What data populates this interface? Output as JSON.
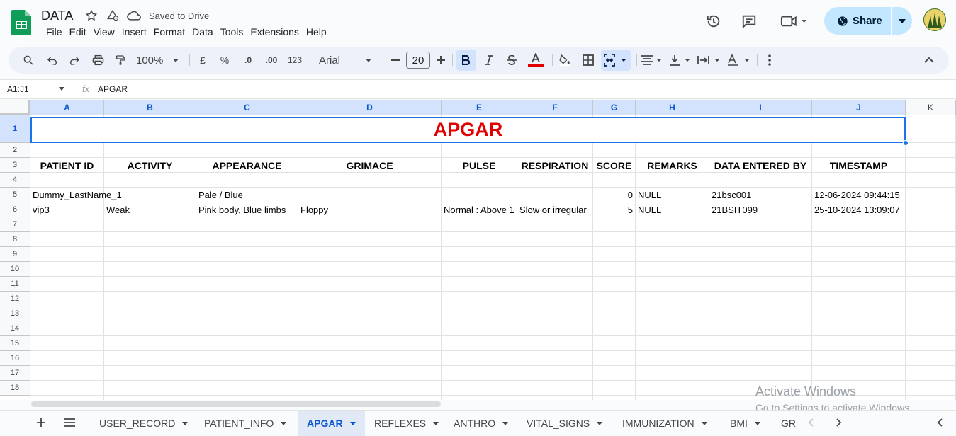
{
  "app": {
    "doc_title": "DATA",
    "saved_status": "Saved to Drive",
    "menu": [
      "File",
      "Edit",
      "View",
      "Insert",
      "Format",
      "Data",
      "Tools",
      "Extensions",
      "Help"
    ],
    "share_label": "Share",
    "accent": "#0b57d0"
  },
  "toolbar": {
    "zoom": "100%",
    "currency": "£",
    "percent": "%",
    "dec_decrease": ".0",
    "dec_increase": ".00",
    "number_format": "123",
    "font": "Arial",
    "font_size": "20"
  },
  "formula_bar": {
    "name_box": "A1:J1",
    "fx": "fx",
    "value": "APGAR"
  },
  "grid": {
    "columns": [
      "A",
      "B",
      "C",
      "D",
      "E",
      "F",
      "G",
      "H",
      "I",
      "J",
      "K"
    ],
    "rows": [
      "1",
      "2",
      "3",
      "4",
      "5",
      "6",
      "7",
      "8",
      "9",
      "10",
      "11",
      "12",
      "13",
      "14",
      "15",
      "16",
      "17",
      "18"
    ],
    "title": "APGAR",
    "title_color": "#e00000",
    "headers": [
      "PATIENT ID",
      "ACTIVITY",
      "APPEARANCE",
      "GRIMACE",
      "PULSE",
      "RESPIRATION",
      "SCORE",
      "REMARKS",
      "DATA ENTERED BY",
      "TIMESTAMP"
    ],
    "data_rows": [
      {
        "row": "5",
        "cells": [
          "Dummy_LastName_1",
          "",
          "Pale / Blue",
          "",
          "",
          "",
          "0",
          "NULL",
          "21bsc001",
          "12-06-2024 09:44:15"
        ]
      },
      {
        "row": "6",
        "cells": [
          "vip3",
          "Weak",
          "Pink body, Blue limbs",
          "Floppy",
          "Normal : Above 1",
          "Slow or irregular",
          "5",
          "NULL",
          "21BSIT099",
          "25-10-2024 13:09:07"
        ]
      }
    ]
  },
  "sheets": {
    "tabs": [
      "USER_RECORD",
      "PATIENT_INFO",
      "APGAR",
      "REFLEXES",
      "ANTHRO",
      "VITAL_SIGNS",
      "IMMUNIZATION",
      "BMI",
      "GR"
    ],
    "active": "APGAR"
  },
  "watermark": {
    "line1": "Activate Windows",
    "line2": "Go to Settings to activate Windows."
  }
}
